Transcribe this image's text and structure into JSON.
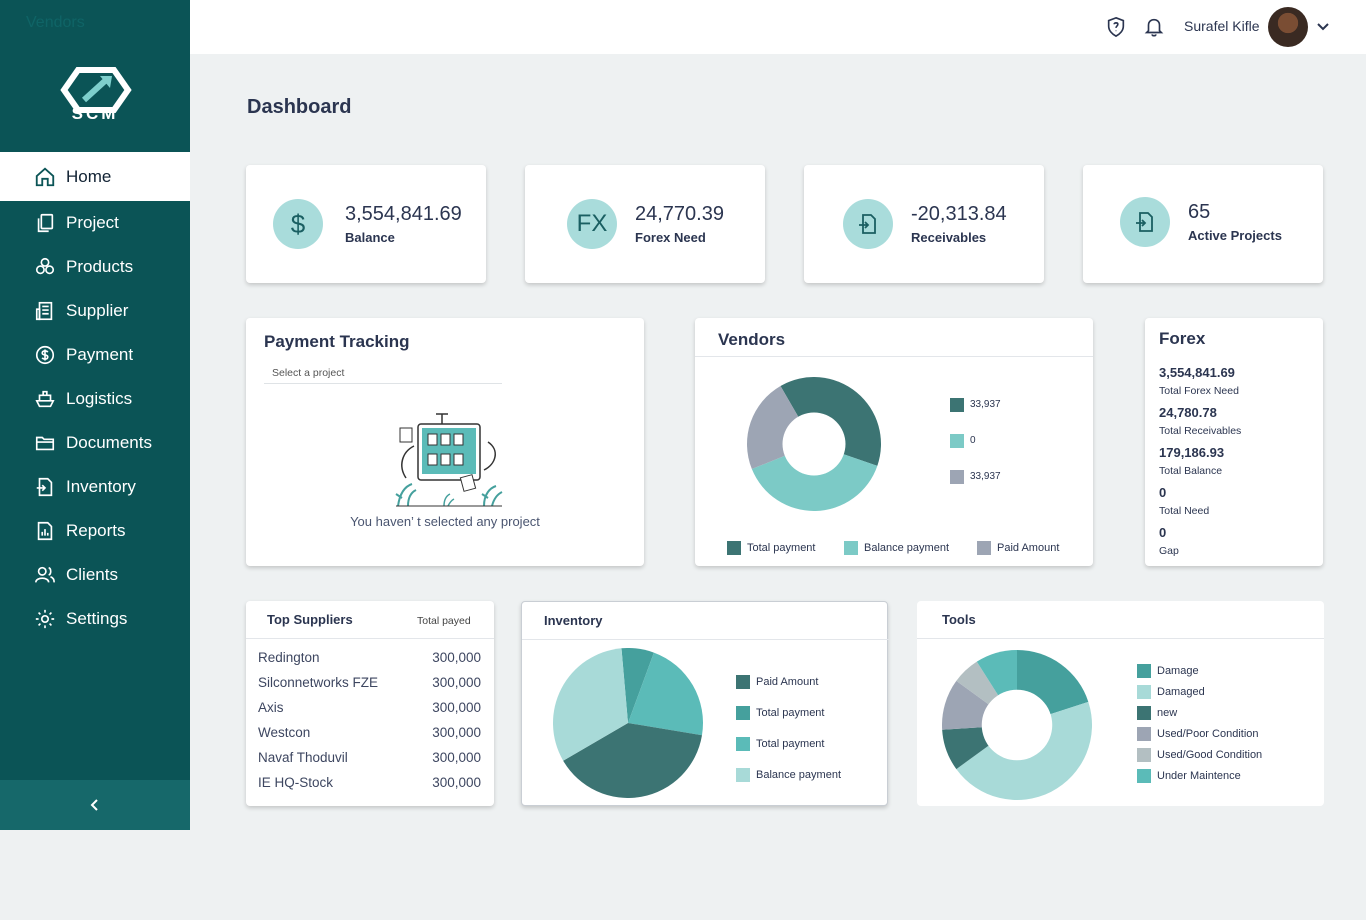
{
  "sidebar": {
    "ghost_text": "Vendors",
    "logo_text": "SCM",
    "items": [
      {
        "label": "Home",
        "icon": "home-icon"
      },
      {
        "label": "Project",
        "icon": "copy-icon"
      },
      {
        "label": "Products",
        "icon": "boxes-icon"
      },
      {
        "label": "Supplier",
        "icon": "building-icon"
      },
      {
        "label": "Payment",
        "icon": "dollar-circle-icon"
      },
      {
        "label": "Logistics",
        "icon": "ship-icon"
      },
      {
        "label": "Documents",
        "icon": "folder-icon"
      },
      {
        "label": "Inventory",
        "icon": "file-import-icon"
      },
      {
        "label": "Reports",
        "icon": "report-icon"
      },
      {
        "label": "Clients",
        "icon": "users-icon"
      },
      {
        "label": "Settings",
        "icon": "gear-icon"
      }
    ],
    "active": "Home"
  },
  "header": {
    "user_name": "Surafel Kifle"
  },
  "page_title": "Dashboard",
  "stats": [
    {
      "icon": "$",
      "value": "3,554,841.69",
      "label": "Balance"
    },
    {
      "icon": "FX",
      "value": "24,770.39",
      "label": "Forex Need"
    },
    {
      "icon": "import",
      "value": "-20,313.84",
      "label": "Receivables"
    },
    {
      "icon": "import",
      "value": "65",
      "label": "Active Projects"
    }
  ],
  "payment_tracking": {
    "title": "Payment Tracking",
    "select_placeholder": "Select a project",
    "empty_message": "You haven’ t selected any project"
  },
  "vendors": {
    "title": "Vendors",
    "side_legend": [
      "33,937",
      "0",
      "33,937"
    ],
    "bottom_legend": [
      "Total payment",
      "Balance payment",
      "Paid Amount"
    ]
  },
  "forex": {
    "title": "Forex",
    "rows": [
      {
        "value": "3,554,841.69",
        "label": "Total Forex Need"
      },
      {
        "value": "24,780.78",
        "label": "Total Receivables"
      },
      {
        "value": "179,186.93",
        "label": "Total Balance"
      },
      {
        "value": "0",
        "label": "Total Need"
      },
      {
        "value": "0",
        "label": "Gap"
      }
    ]
  },
  "top_suppliers": {
    "title": "Top Suppliers",
    "column": "Total payed",
    "rows": [
      {
        "name": "Redington",
        "amount": "300,000"
      },
      {
        "name": "Silconnetworks FZE",
        "amount": "300,000"
      },
      {
        "name": "Axis",
        "amount": "300,000"
      },
      {
        "name": "Westcon",
        "amount": "300,000"
      },
      {
        "name": "Navaf Thoduvil",
        "amount": "300,000"
      },
      {
        "name": "IE HQ-Stock",
        "amount": "300,000"
      }
    ]
  },
  "inventory": {
    "title": "Inventory",
    "legend": [
      "Paid Amount",
      "Total payment",
      "Total payment",
      "Balance payment"
    ]
  },
  "tools": {
    "title": "Tools",
    "legend": [
      "Damage",
      "Damaged",
      "new",
      "Used/Poor Condition",
      "Used/Good Condition",
      "Under Maintence"
    ]
  },
  "chart_data": [
    {
      "type": "pie",
      "title": "Vendors",
      "slices": [
        {
          "name": "Total payment",
          "value": 33937,
          "color": "#3c7473"
        },
        {
          "name": "Balance payment",
          "value": 33937,
          "color": "#7ccac6"
        },
        {
          "name": "Paid Amount",
          "value": 20000,
          "color": "#9da5b4"
        }
      ],
      "donut": true
    },
    {
      "type": "pie",
      "title": "Inventory",
      "slices": [
        {
          "name": "Total payment",
          "value": 7,
          "color": "#45a09d"
        },
        {
          "name": "Total payment",
          "value": 22,
          "color": "#5bbbb8"
        },
        {
          "name": "Paid Amount",
          "value": 39,
          "color": "#3c7473"
        },
        {
          "name": "Balance payment",
          "value": 32,
          "color": "#a8dad8"
        }
      ]
    },
    {
      "type": "pie",
      "title": "Tools",
      "slices": [
        {
          "name": "Damage",
          "value": 20,
          "color": "#45a09d"
        },
        {
          "name": "Damaged",
          "value": 45,
          "color": "#a8dad8"
        },
        {
          "name": "new",
          "value": 9,
          "color": "#3c7473"
        },
        {
          "name": "Used/Poor Condition",
          "value": 11,
          "color": "#9da5b4"
        },
        {
          "name": "Used/Good Condition",
          "value": 6,
          "color": "#b3bfc2"
        },
        {
          "name": "Under Maintence",
          "value": 9,
          "color": "#5bbbb8"
        }
      ],
      "donut": true
    }
  ]
}
